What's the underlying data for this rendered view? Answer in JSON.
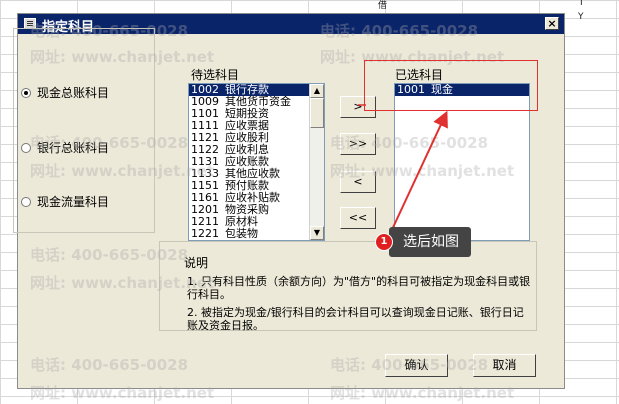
{
  "dialog": {
    "title": "指定科目",
    "close_label": "×"
  },
  "radios": [
    {
      "label": "现金总账科目",
      "checked": true
    },
    {
      "label": "银行总账科目",
      "checked": false
    },
    {
      "label": "现金流量科目",
      "checked": false
    }
  ],
  "candidates": {
    "label": "待选科目",
    "items": [
      {
        "code": "1002",
        "name": "银行存款",
        "selected": true
      },
      {
        "code": "1009",
        "name": "其他货币资金"
      },
      {
        "code": "1101",
        "name": "短期投资"
      },
      {
        "code": "1111",
        "name": "应收票据"
      },
      {
        "code": "1121",
        "name": "应收股利"
      },
      {
        "code": "1122",
        "name": "应收利息"
      },
      {
        "code": "1131",
        "name": "应收账款"
      },
      {
        "code": "1133",
        "name": "其他应收款"
      },
      {
        "code": "1151",
        "name": "预付账款"
      },
      {
        "code": "1161",
        "name": "应收补贴款"
      },
      {
        "code": "1201",
        "name": "物资采购"
      },
      {
        "code": "1211",
        "name": "原材料"
      },
      {
        "code": "1221",
        "name": "包装物"
      }
    ]
  },
  "selected": {
    "label": "已选科目",
    "items": [
      {
        "code": "1001",
        "name": "现金",
        "selected": true
      }
    ]
  },
  "transfer_buttons": [
    ">",
    ">>",
    "<",
    "<<"
  ],
  "description": {
    "label": "说明",
    "line1": "1. 只有科目性质（余额方向）为\"借方\"的科目可被指定为现金科目或银行科目。",
    "line2": "2. 被指定为现金/银行科目的会计科目可以查询现金日记账、银行日记账及资金日报。"
  },
  "footer": {
    "ok_label": "确认",
    "cancel_label": "取消"
  },
  "callout": {
    "badge": "1",
    "text": "选后如图"
  },
  "sheet": {
    "cell_a": "借",
    "cell_b": "Y",
    "cell_c": "I"
  },
  "watermarks": {
    "phone": "电话: 400-665-0028",
    "site": "网址: www.chanjet.net"
  },
  "colors": {
    "title_bar": "#0a246a",
    "selection": "#0a246a",
    "dialog_bg": "#ece9d8",
    "annotation_red": "#e03030"
  }
}
